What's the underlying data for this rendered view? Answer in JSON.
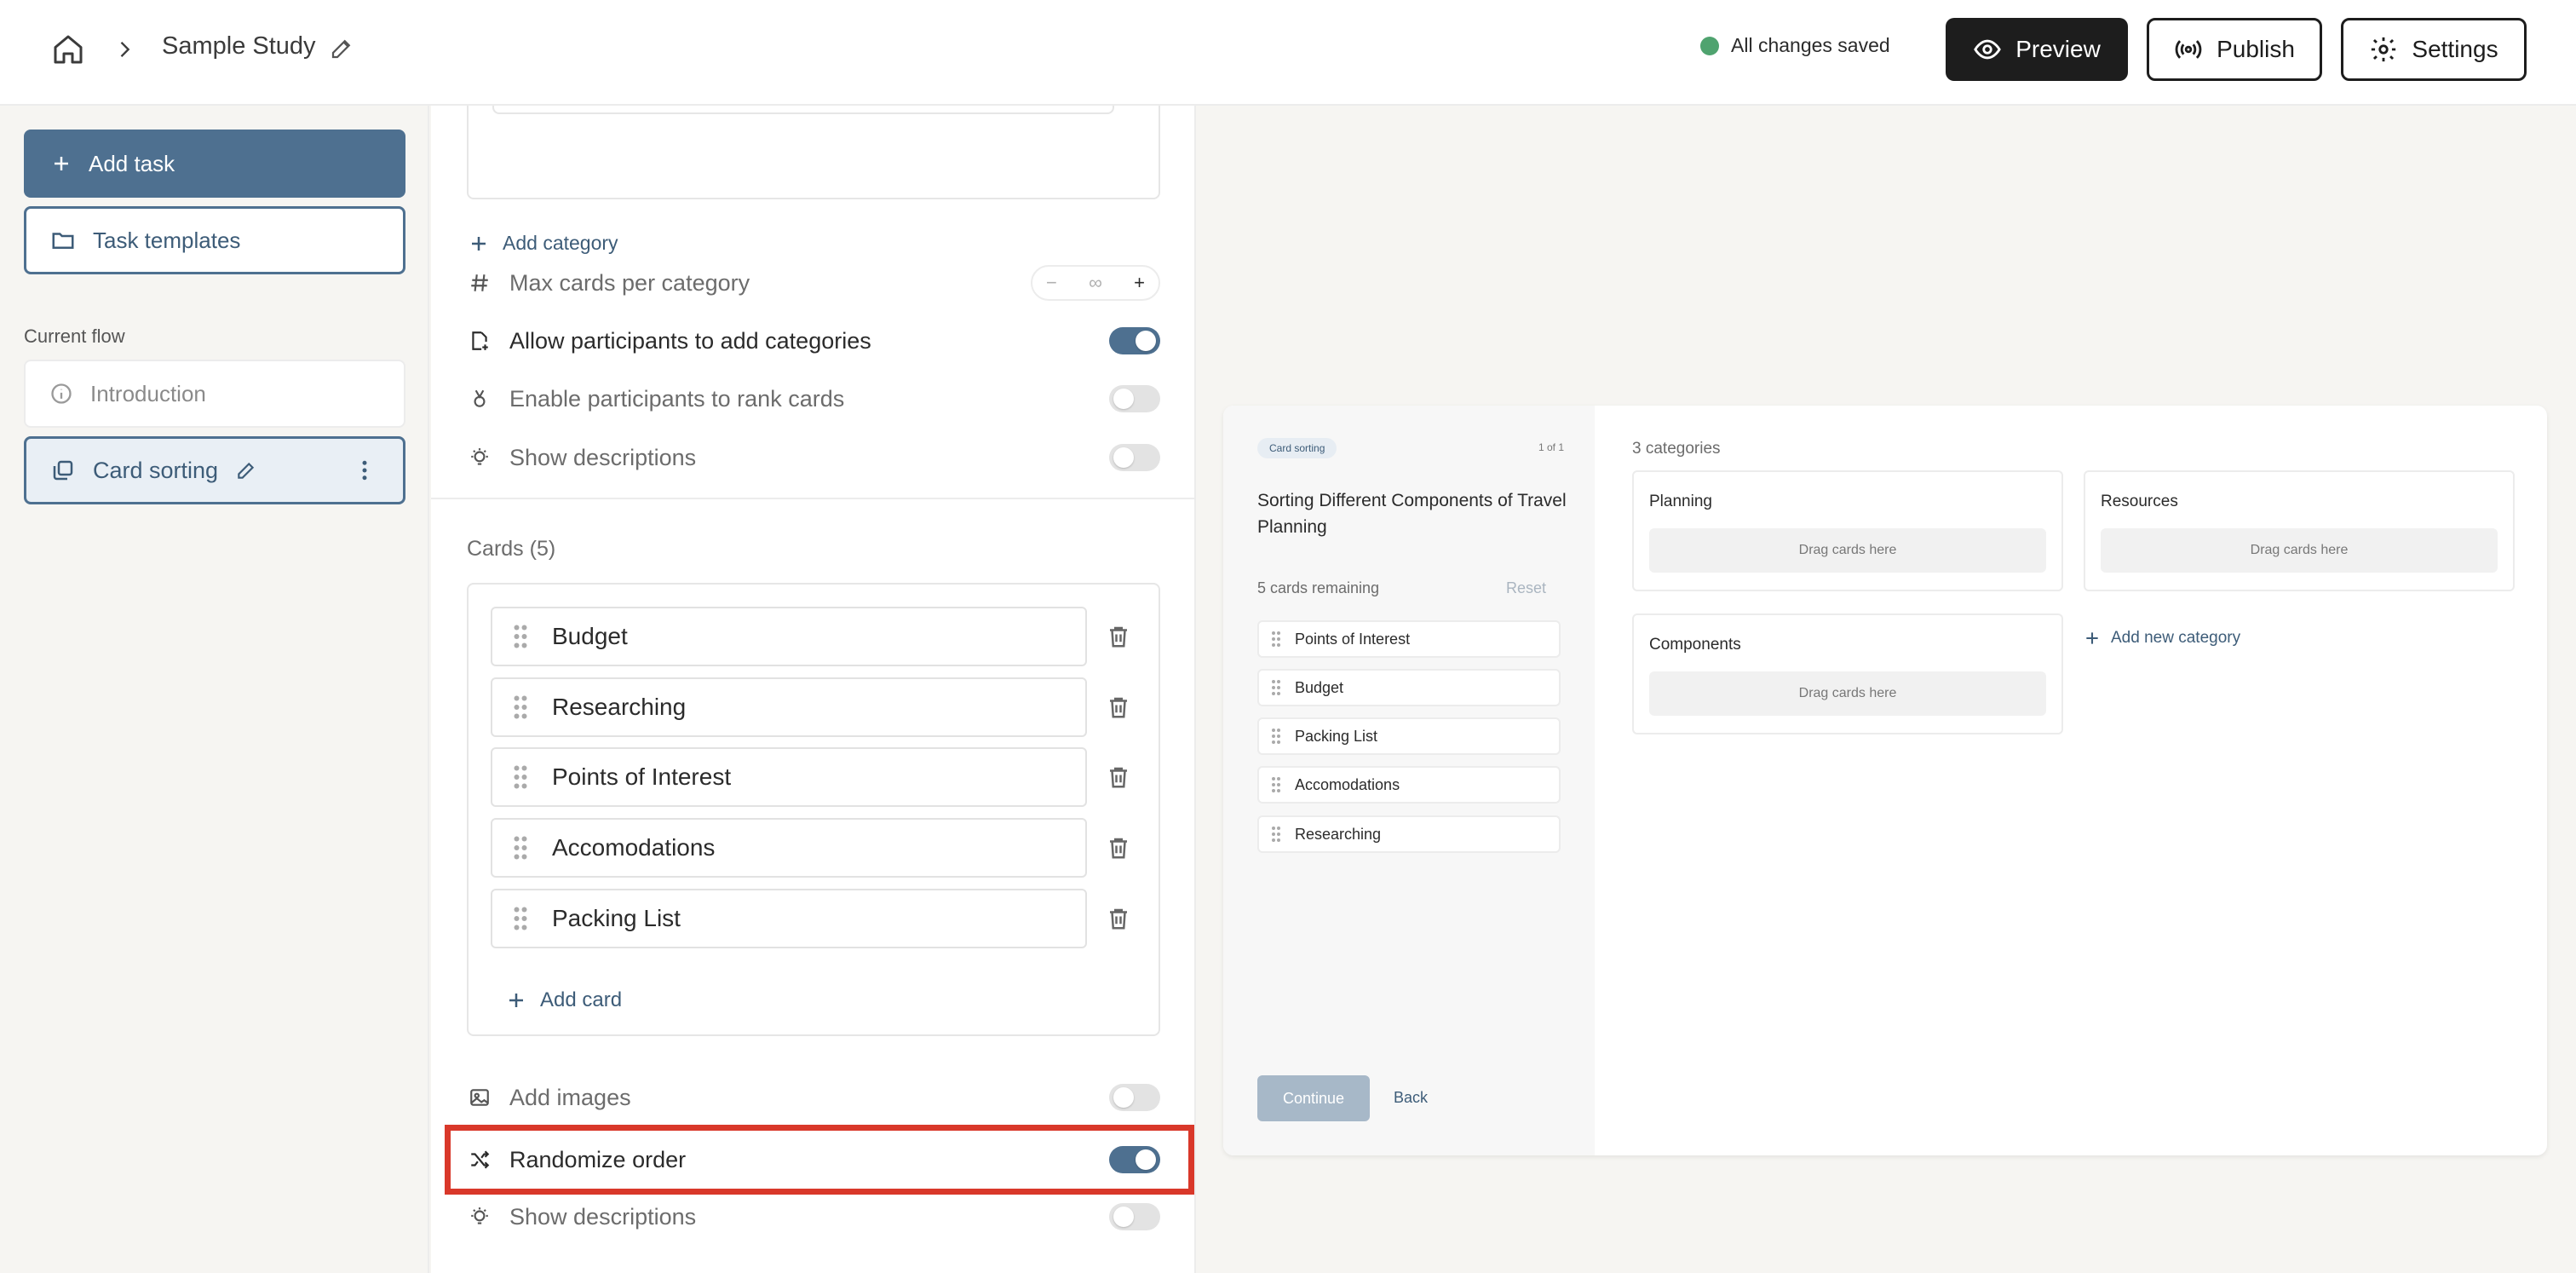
{
  "colors": {
    "accent": "#4e7090",
    "dark": "#1d1d1d",
    "saved_dot": "#4fa36f",
    "highlight": "#d9382a"
  },
  "header": {
    "home_icon": "home-icon",
    "study_name": "Sample Study",
    "save_status": "All changes saved",
    "preview_label": "Preview",
    "publish_label": "Publish",
    "settings_label": "Settings"
  },
  "sidebar": {
    "add_task_label": "Add task",
    "task_templates_label": "Task templates",
    "current_flow_label": "Current flow",
    "flow_items": [
      {
        "label": "Introduction",
        "icon": "info-icon"
      },
      {
        "label": "Card sorting",
        "icon": "cards-icon",
        "selected": true
      }
    ]
  },
  "editor": {
    "add_category_label": "Add category",
    "settings_top": [
      {
        "label": "Max cards per category",
        "icon": "hash-icon",
        "type": "stepper",
        "value": "∞"
      },
      {
        "label": "Allow participants to add categories",
        "icon": "add-category-icon",
        "type": "toggle",
        "on": true
      },
      {
        "label": "Enable participants to rank cards",
        "icon": "medal-icon",
        "type": "toggle",
        "on": false
      },
      {
        "label": "Show descriptions",
        "icon": "bulb-icon",
        "type": "toggle",
        "on": false
      }
    ],
    "cards_title": "Cards (5)",
    "cards": [
      "Budget",
      "Researching",
      "Points of Interest",
      "Accomodations",
      "Packing List"
    ],
    "add_card_label": "Add card",
    "settings_bottom": [
      {
        "label": "Add images",
        "icon": "image-icon",
        "on": false
      },
      {
        "label": "Randomize order",
        "icon": "shuffle-icon",
        "on": true
      },
      {
        "label": "Show descriptions",
        "icon": "bulb-icon",
        "on": false
      }
    ]
  },
  "preview": {
    "badge": "Card sorting",
    "progress": "1 of 1",
    "title": "Sorting Different Components of Travel Planning",
    "remaining": "5 cards remaining",
    "reset_label": "Reset",
    "cards": [
      "Points of Interest",
      "Budget",
      "Packing List",
      "Accomodations",
      "Researching"
    ],
    "continue_label": "Continue",
    "back_label": "Back",
    "categories_count": "3 categories",
    "categories": [
      "Planning",
      "Resources",
      "Components"
    ],
    "drop_hint": "Drag cards here",
    "add_category_label": "Add new category"
  }
}
